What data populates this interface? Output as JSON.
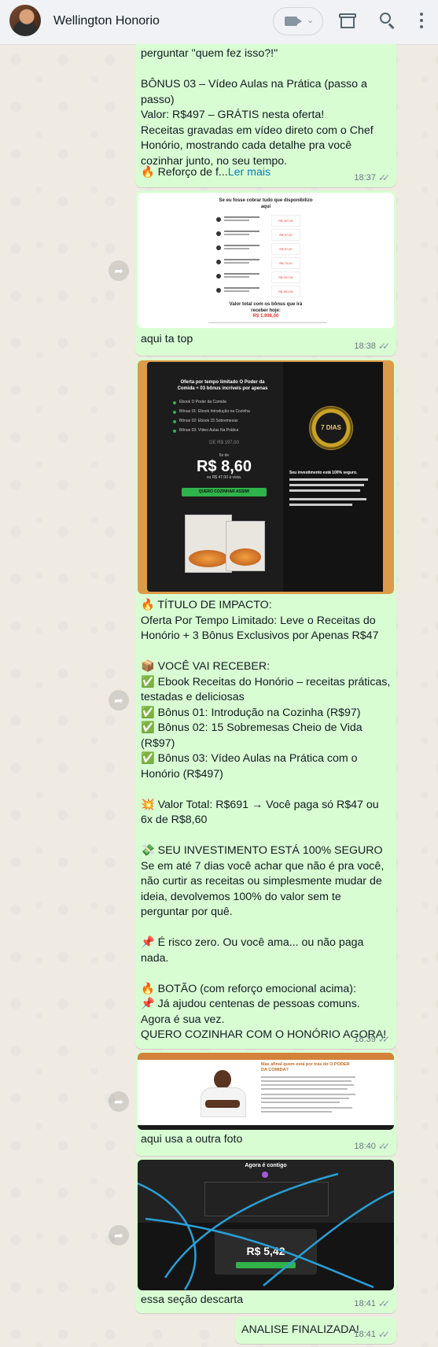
{
  "header": {
    "contact_name": "Wellington Honorio",
    "icons": [
      "avatar",
      "video-call-icon",
      "chevron-down-icon",
      "store-icon",
      "search-icon",
      "menu-icon"
    ]
  },
  "messages": [
    {
      "id": "m1",
      "text": "perguntar \"quem fez isso?!\"\n\nBÔNUS 03 – Vídeo Aulas na Prática (passo a passo)\nValor: R$497 – GRÁTIS nesta oferta!\nReceitas gravadas em vídeo direto com o Chef Honório, mostrando cada detalhe pra você cozinhar junto, no seu tempo.",
      "last_line_prefix": "🔥 Reforço de f...",
      "read_more": "Ler mais",
      "time": "18:37"
    },
    {
      "id": "m2",
      "image_label": {
        "title": "Se eu fosse cobrar tudo que disponibilizo aqui",
        "total": "Valor total com os bônus que irá receber hoje:",
        "total_value": "R$ 1.998,00"
      },
      "caption": "aqui ta top",
      "time": "18:38"
    },
    {
      "id": "m3",
      "image_label": {
        "headline": "Oferta por tempo limitado O Poder da Comida + 03 bônus incríveis por apenas",
        "items": [
          "Ebook O Poder da Comida",
          "Bônus 01: Ebook Introdução na Cozinha",
          "Bônus 02: Ebook 15 Sobremesas",
          "Bônus 03: Vídeo Aulas Na Prática"
        ],
        "from_price": "DE R$ 197,00",
        "installments": "6x de",
        "price": "R$ 8,60",
        "cash": "ou R$ 47,00 à vista.",
        "cta": "QUERO COZINHAR ASSIM!",
        "badge": "7 DIAS",
        "guarantee": "Seu investimento está 100% seguro.",
        "book_title": "O Poder da Comida"
      },
      "text": "🔥 TÍTULO DE IMPACTO:\nOferta Por Tempo Limitado: Leve o Receitas do Honório + 3 Bônus Exclusivos por Apenas R$47\n\n📦 VOCÊ VAI RECEBER:\n✅ Ebook Receitas do Honório – receitas práticas, testadas e deliciosas\n✅ Bônus 01: Introdução na Cozinha (R$97)\n✅ Bônus 02: 15 Sobremesas Cheio de Vida (R$97)\n✅ Bônus 03: Vídeo Aulas na Prática com o Honório (R$497)\n\n💥 Valor Total: R$691 → Você paga só R$47 ou 6x de R$8,60\n\n💸 SEU INVESTIMENTO ESTÁ 100% SEGURO\nSe em até 7 dias você achar que não é pra você, não curtir as receitas ou simplesmente mudar de ideia, devolvemos 100% do valor sem te perguntar por quê.\n\n📌 É risco zero. Ou você ama... ou não paga nada.\n\n🔥 BOTÃO (com reforço emocional acima):\n📌 Já ajudou centenas de pessoas comuns. Agora é sua vez.\nQUERO COZINHAR COM O HONÓRIO AGORA!",
      "time": "18:39"
    },
    {
      "id": "m4",
      "image_label": {
        "headline": "Mas afinal quem está por trás do O PODER DA COMIDA?"
      },
      "caption": "aqui usa a outra foto",
      "time": "18:40"
    },
    {
      "id": "m5",
      "image_label": {
        "title": "Agora é contigo",
        "price": "R$ 5,42"
      },
      "caption": "essa seção descarta",
      "time": "18:41"
    },
    {
      "id": "m6",
      "text": "ANALISE FINALIZADA!",
      "time": "18:41"
    }
  ],
  "colors": {
    "outgoing_bubble": "#d9fdd3",
    "chat_background": "#efeae2",
    "header_background": "#f0f2f5",
    "link": "#027eb5",
    "meta": "#667781"
  }
}
